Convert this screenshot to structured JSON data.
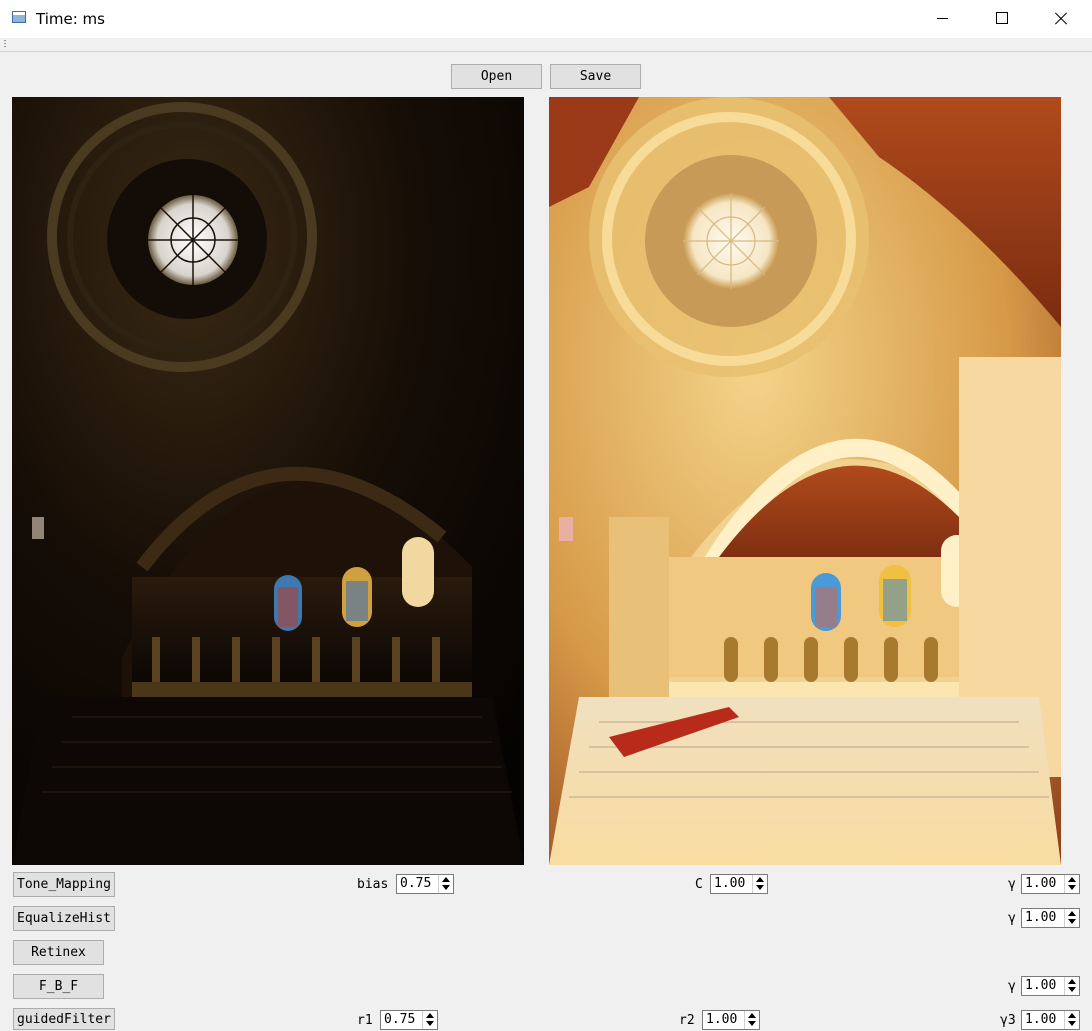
{
  "window": {
    "title": "Time: ms",
    "icon": "app-window-icon",
    "controls": [
      "minimize-icon",
      "maximize-icon",
      "close-icon"
    ]
  },
  "toolbar": {
    "open_label": "Open",
    "save_label": "Save"
  },
  "images": {
    "left": "original dark HDR image of cathedral dome interior",
    "right": "tone-mapped bright result of cathedral dome interior"
  },
  "rows": {
    "tone_mapping": {
      "button": "Tone_Mapping",
      "bias_label": "bias",
      "bias_value": "0.75",
      "c_label": "C",
      "c_value": "1.00",
      "gamma_label": "γ",
      "gamma_value": "1.00"
    },
    "equalize_hist": {
      "button": "EqualizeHist",
      "gamma_label": "γ",
      "gamma_value": "1.00"
    },
    "retinex": {
      "button": "Retinex"
    },
    "fbf": {
      "button": "F_B_F",
      "gamma_label": "γ",
      "gamma_value": "1.00"
    },
    "guided_filter": {
      "button": "guidedFilter",
      "r1_label": "r1",
      "r1_value": "0.75",
      "r2_label": "r2",
      "r2_value": "1.00",
      "gamma3_label": "γ3",
      "gamma3_value": "1.00"
    }
  },
  "colors": {
    "window_bg": "#f0f0f0",
    "button_bg": "#e1e1e1",
    "button_border": "#adadad"
  }
}
